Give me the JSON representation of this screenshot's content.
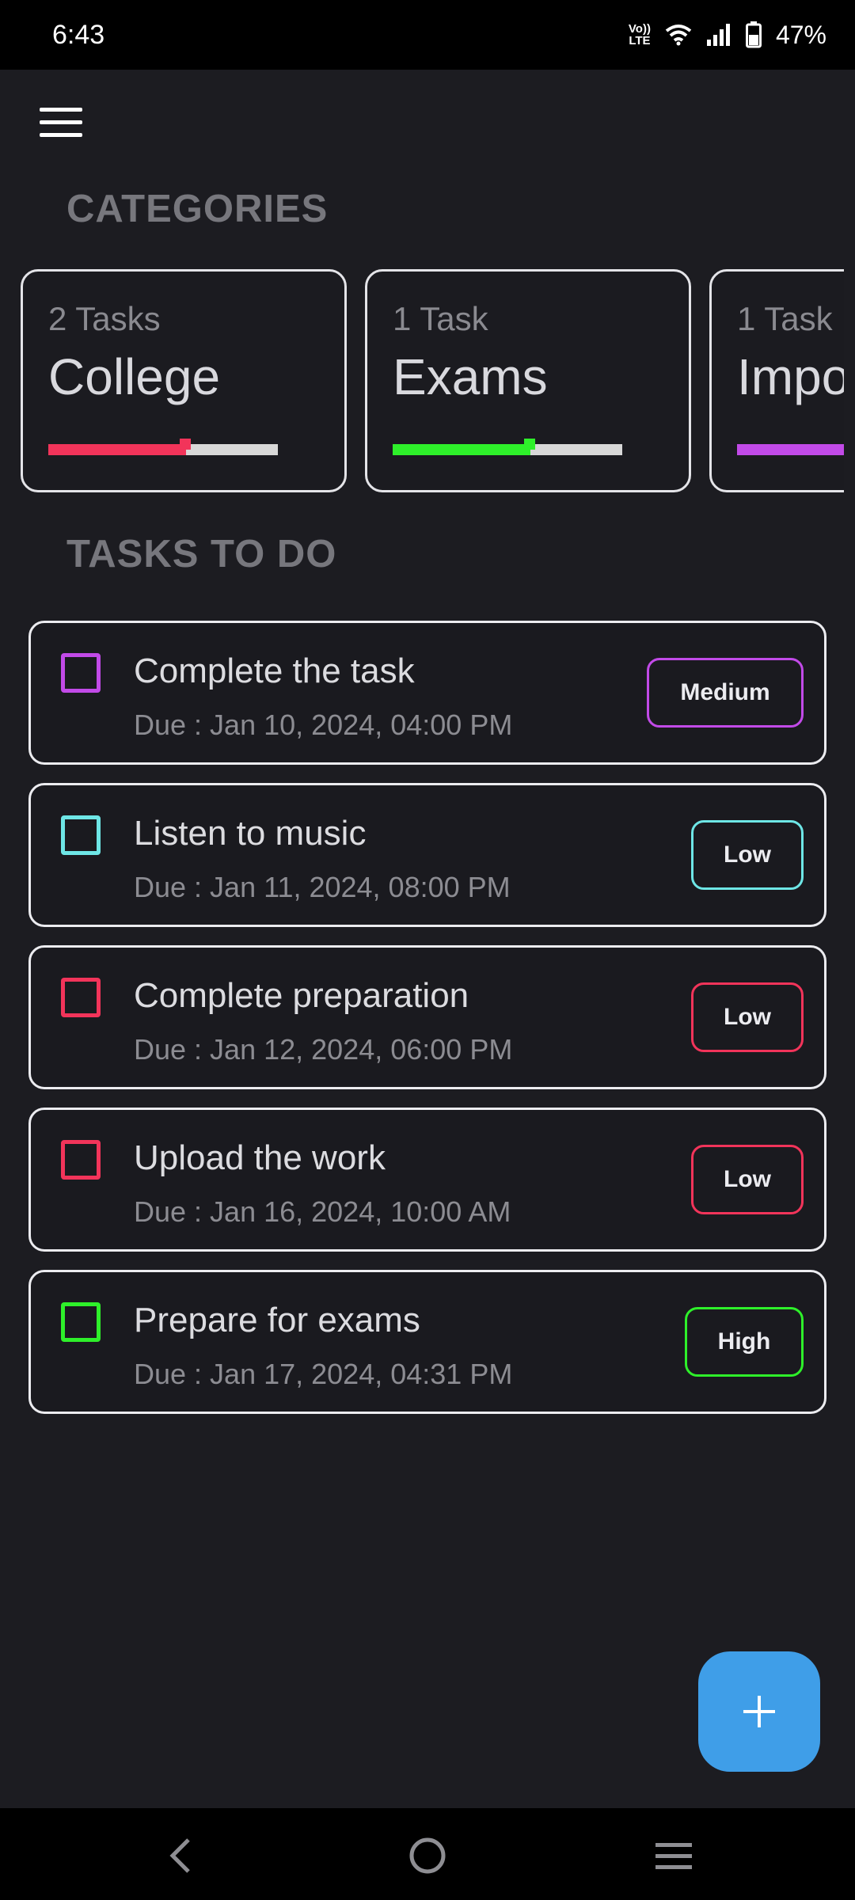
{
  "status_bar": {
    "time": "6:43",
    "volte_top": "Vo))",
    "volte_bottom": "LTE",
    "battery": "47%"
  },
  "header": {
    "menu_icon": "hamburger-menu-icon"
  },
  "categories": {
    "title": "CATEGORIES",
    "items": [
      {
        "count": "2 Tasks",
        "name": "College",
        "color": "#f2345a",
        "progress": 0.6
      },
      {
        "count": "1 Task",
        "name": "Exams",
        "color": "#2ef02a",
        "progress": 0.6
      },
      {
        "count": "1 Task",
        "name": "Impo",
        "color": "#c24ae8",
        "progress": 0.6
      }
    ]
  },
  "tasks": {
    "title": "TASKS TO DO",
    "items": [
      {
        "title": "Complete the task",
        "due": "Due : Jan 10, 2024, 04:00 PM",
        "priority": "Medium",
        "color": "#c24ae8"
      },
      {
        "title": "Listen to music",
        "due": "Due : Jan 11, 2024, 08:00 PM",
        "priority": "Low",
        "color": "#6ee6e6"
      },
      {
        "title": "Complete preparation",
        "due": "Due : Jan 12, 2024, 06:00 PM",
        "priority": "Low",
        "color": "#f2345a"
      },
      {
        "title": "Upload the work",
        "due": "Due : Jan 16, 2024, 10:00 AM",
        "priority": "Low",
        "color": "#f2345a"
      },
      {
        "title": "Prepare for exams",
        "due": "Due : Jan 17, 2024, 04:31 PM",
        "priority": "High",
        "color": "#2ef02a"
      }
    ]
  },
  "fab": {
    "icon": "plus-icon",
    "color": "#3f9ee8"
  },
  "nav_bar": {
    "back_icon": "back-icon",
    "home_icon": "home-icon",
    "recents_icon": "recents-icon"
  }
}
